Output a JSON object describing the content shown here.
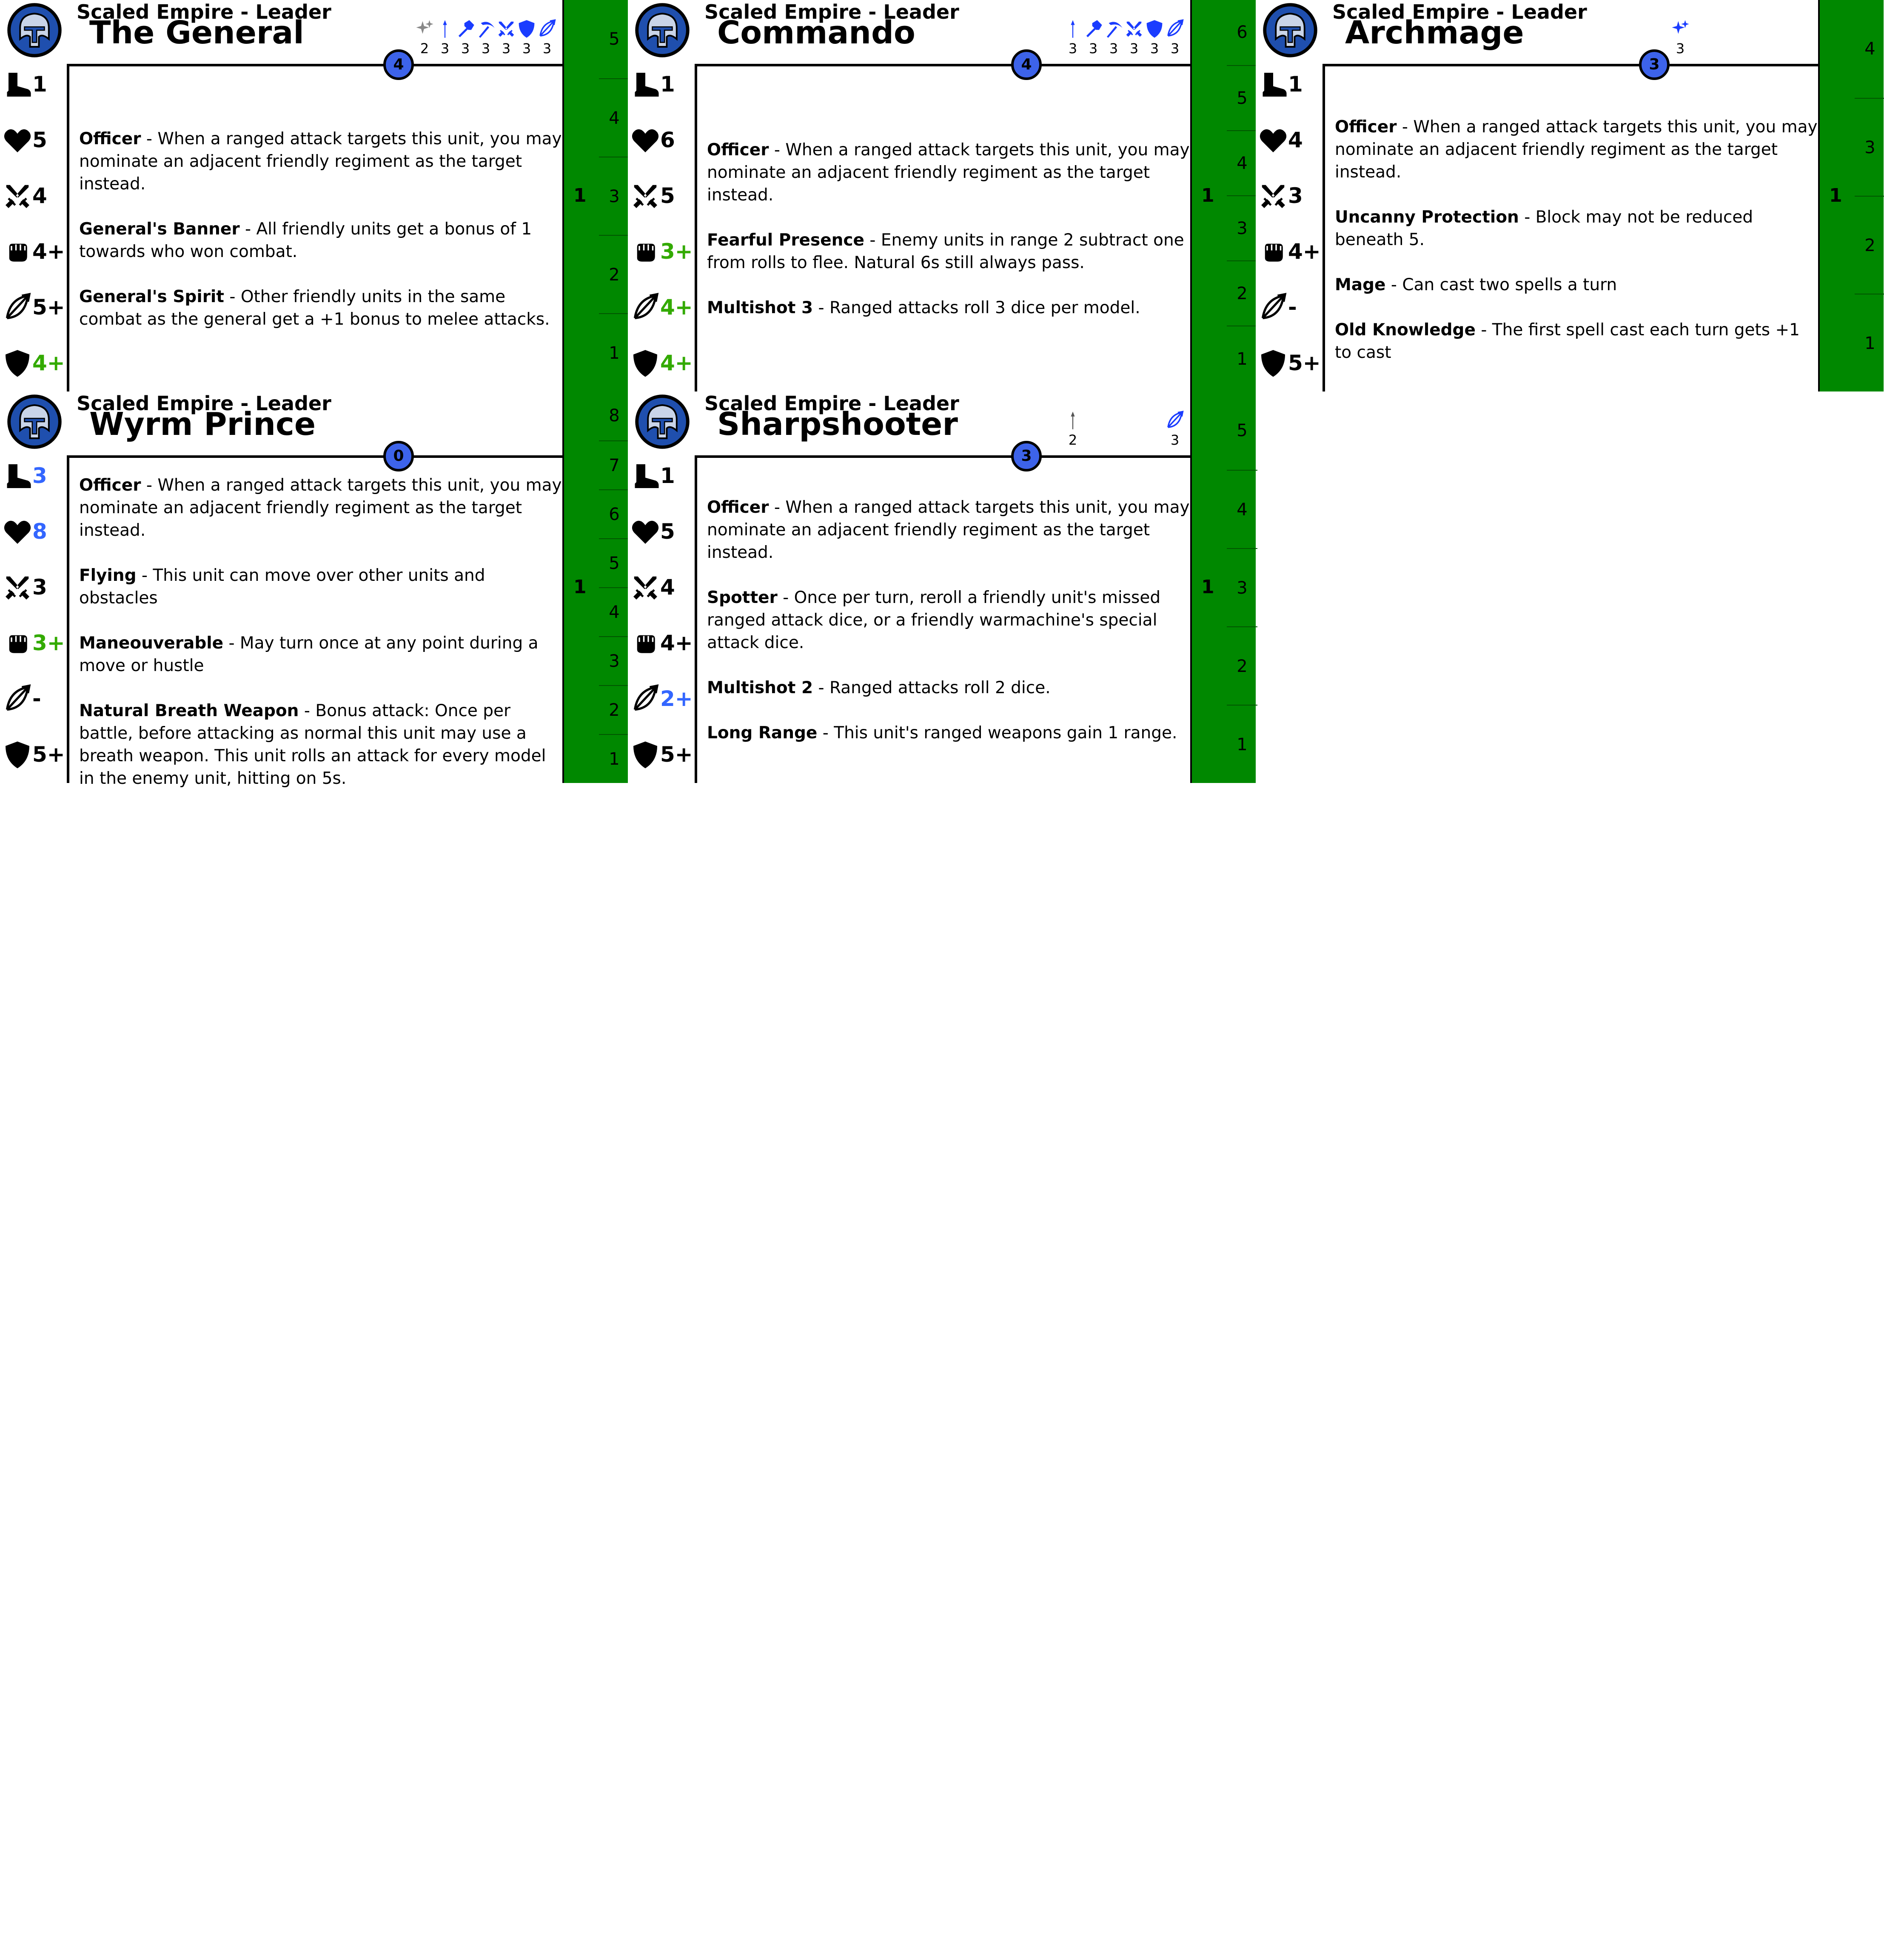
{
  "colors": {
    "accent_blue": "#3d63ea",
    "green_track": "#008800",
    "green_value": "#33aa00",
    "blue_value": "#3366ff",
    "grey_value": "#888888"
  },
  "cards": [
    {
      "faction": "Scaled Empire - Leader",
      "name": "The General",
      "cost": "4",
      "weapons": [
        {
          "icon": "magic-sparkle-icon",
          "value": "2",
          "color": "#888888"
        },
        {
          "icon": "spear-icon",
          "value": "3",
          "color": "#1a3cff"
        },
        {
          "icon": "hammer-icon",
          "value": "3",
          "color": "#1a3cff"
        },
        {
          "icon": "pickaxe-icon",
          "value": "3",
          "color": "#1a3cff"
        },
        {
          "icon": "crossed-swords-icon",
          "value": "3",
          "color": "#1a3cff"
        },
        {
          "icon": "shield-icon",
          "value": "3",
          "color": "#1a3cff"
        },
        {
          "icon": "bow-icon",
          "value": "3",
          "color": "#1a3cff"
        }
      ],
      "stats": [
        {
          "icon": "boot-icon",
          "value": "1",
          "color": "#000000"
        },
        {
          "icon": "heart-icon",
          "value": "5",
          "color": "#000000"
        },
        {
          "icon": "crossed-swords-icon",
          "value": "4",
          "color": "#000000"
        },
        {
          "icon": "fist-icon",
          "value": "4+",
          "color": "#000000"
        },
        {
          "icon": "bow-icon",
          "value": "5+",
          "color": "#000000"
        },
        {
          "icon": "shield-icon",
          "value": "4+",
          "color": "#33aa00"
        }
      ],
      "abilities": [
        {
          "name": "Officer",
          "text": " - When a ranged attack targets this unit, you may nominate an adjacent friendly regiment as the target instead."
        },
        {
          "name": "General's Banner",
          "text": " - All friendly units get a bonus of 1 towards who won combat."
        },
        {
          "name": "General's Spirit",
          "text": " - Other friendly units in the same combat as the general get a +1 bonus to melee attacks."
        }
      ],
      "track_count": "1",
      "track": [
        "5",
        "4",
        "3",
        "2",
        "1"
      ]
    },
    {
      "faction": "Scaled Empire - Leader",
      "name": "Commando",
      "cost": "4",
      "weapons": [
        {
          "icon": "spear-icon",
          "value": "3",
          "color": "#1a3cff"
        },
        {
          "icon": "hammer-icon",
          "value": "3",
          "color": "#1a3cff"
        },
        {
          "icon": "pickaxe-icon",
          "value": "3",
          "color": "#1a3cff"
        },
        {
          "icon": "crossed-swords-icon",
          "value": "3",
          "color": "#1a3cff"
        },
        {
          "icon": "shield-icon",
          "value": "3",
          "color": "#1a3cff"
        },
        {
          "icon": "bow-icon",
          "value": "3",
          "color": "#1a3cff"
        }
      ],
      "stats": [
        {
          "icon": "boot-icon",
          "value": "1",
          "color": "#000000"
        },
        {
          "icon": "heart-icon",
          "value": "6",
          "color": "#000000"
        },
        {
          "icon": "crossed-swords-icon",
          "value": "5",
          "color": "#000000"
        },
        {
          "icon": "fist-icon",
          "value": "3+",
          "color": "#33aa00"
        },
        {
          "icon": "bow-icon",
          "value": "4+",
          "color": "#33aa00"
        },
        {
          "icon": "shield-icon",
          "value": "4+",
          "color": "#33aa00"
        }
      ],
      "abilities": [
        {
          "name": "Officer",
          "text": " - When a ranged attack targets this unit, you may nominate an adjacent friendly regiment as the target instead."
        },
        {
          "name": "Fearful Presence",
          "text": " - Enemy units in range 2 subtract one from rolls to flee. Natural 6s still always pass."
        },
        {
          "name": "Multishot 3",
          "text": " - Ranged attacks roll 3 dice per model."
        }
      ],
      "track_count": "1",
      "track": [
        "6",
        "5",
        "4",
        "3",
        "2",
        "1"
      ]
    },
    {
      "faction": "Scaled Empire - Leader",
      "name": "Archmage",
      "cost": "3",
      "weapons": [
        {
          "icon": "magic-sparkle-icon",
          "value": "3",
          "color": "#1a3cff"
        }
      ],
      "stats": [
        {
          "icon": "boot-icon",
          "value": "1",
          "color": "#000000"
        },
        {
          "icon": "heart-icon",
          "value": "4",
          "color": "#000000"
        },
        {
          "icon": "crossed-swords-icon",
          "value": "3",
          "color": "#000000"
        },
        {
          "icon": "fist-icon",
          "value": "4+",
          "color": "#000000"
        },
        {
          "icon": "bow-icon",
          "value": "-",
          "color": "#000000"
        },
        {
          "icon": "shield-icon",
          "value": "5+",
          "color": "#000000"
        }
      ],
      "abilities": [
        {
          "name": "Officer",
          "text": " - When a ranged attack targets this unit, you may nominate an adjacent friendly regiment as the target instead."
        },
        {
          "name": "Uncanny Protection",
          "text": " - Block may not be reduced beneath 5."
        },
        {
          "name": "Mage",
          "text": " - Can cast two spells a turn"
        },
        {
          "name": "Old Knowledge",
          "text": " - The first spell cast each turn gets +1 to cast"
        }
      ],
      "track_count": "1",
      "track": [
        "4",
        "3",
        "2",
        "1"
      ]
    },
    {
      "faction": "Scaled Empire - Leader",
      "name": "Wyrm Prince",
      "cost": "0",
      "weapons": [],
      "stats": [
        {
          "icon": "boot-icon",
          "value": "3",
          "color": "#3366ff"
        },
        {
          "icon": "heart-icon",
          "value": "8",
          "color": "#3366ff"
        },
        {
          "icon": "crossed-swords-icon",
          "value": "3",
          "color": "#000000"
        },
        {
          "icon": "fist-icon",
          "value": "3+",
          "color": "#33aa00"
        },
        {
          "icon": "bow-icon",
          "value": "-",
          "color": "#000000"
        },
        {
          "icon": "shield-icon",
          "value": "5+",
          "color": "#000000"
        }
      ],
      "abilities": [
        {
          "name": "Officer",
          "text": " - When a ranged attack targets this unit, you may nominate an adjacent friendly regiment as the target instead."
        },
        {
          "name": "Flying",
          "text": " - This unit can move over other units and obstacles"
        },
        {
          "name": "Maneouverable",
          "text": " - May turn once at any point during a move or hustle"
        },
        {
          "name": "Natural Breath Weapon",
          "text": " - Bonus attack: Once per battle, before attacking as normal this unit may use a breath weapon. This unit rolls an attack for every model in the enemy unit, hitting on 5s."
        }
      ],
      "track_count": "1",
      "track": [
        "8",
        "7",
        "6",
        "5",
        "4",
        "3",
        "2",
        "1"
      ]
    },
    {
      "faction": "Scaled Empire - Leader",
      "name": "Sharpshooter",
      "cost": "3",
      "weapons": [
        {
          "icon": "spear-icon",
          "value": "2",
          "color": "#555555"
        },
        {
          "icon": "bow-icon",
          "value": "3",
          "color": "#1a3cff"
        }
      ],
      "stats": [
        {
          "icon": "boot-icon",
          "value": "1",
          "color": "#000000"
        },
        {
          "icon": "heart-icon",
          "value": "5",
          "color": "#000000"
        },
        {
          "icon": "crossed-swords-icon",
          "value": "4",
          "color": "#000000"
        },
        {
          "icon": "fist-icon",
          "value": "4+",
          "color": "#000000"
        },
        {
          "icon": "bow-icon",
          "value": "2+",
          "color": "#3366ff"
        },
        {
          "icon": "shield-icon",
          "value": "5+",
          "color": "#000000"
        }
      ],
      "abilities": [
        {
          "name": "Officer",
          "text": " - When a ranged attack targets this unit, you may nominate an adjacent friendly regiment as the target instead."
        },
        {
          "name": "Spotter",
          "text": " - Once per turn, reroll a friendly unit's missed ranged attack dice, or a friendly warmachine's special attack dice."
        },
        {
          "name": "Multishot 2",
          "text": " - Ranged attacks roll 2 dice."
        },
        {
          "name": "Long Range",
          "text": " - This unit's ranged weapons gain 1 range."
        }
      ],
      "track_count": "1",
      "track": [
        "5",
        "4",
        "3",
        "2",
        "1"
      ]
    }
  ]
}
